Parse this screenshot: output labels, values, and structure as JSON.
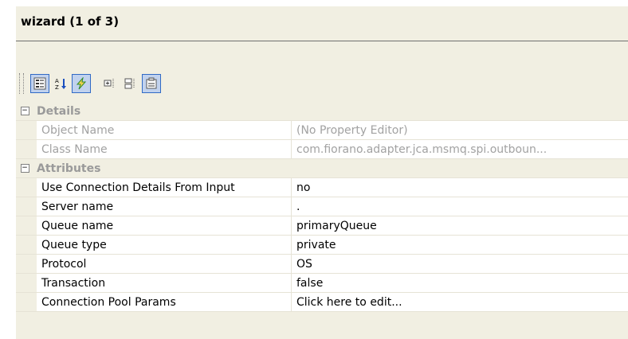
{
  "panel": {
    "title": "wizard (1 of 3)"
  },
  "toolbar": {
    "buttons": [
      {
        "icon": "categorized-icon",
        "active": true
      },
      {
        "icon": "sort-alphabetical-icon",
        "active": false
      },
      {
        "icon": "lightning-icon",
        "active": true
      },
      {
        "icon": "expand-all-icon",
        "active": false
      },
      {
        "icon": "collapse-all-icon",
        "active": false
      },
      {
        "icon": "property-pages-icon",
        "active": true
      }
    ]
  },
  "categories": {
    "details": {
      "label": "Details",
      "rows": [
        {
          "name": "Object Name",
          "value": "(No Property Editor)"
        },
        {
          "name": "Class Name",
          "value": "com.fiorano.adapter.jca.msmq.spi.outboun..."
        }
      ]
    },
    "attributes": {
      "label": "Attributes",
      "rows": [
        {
          "name": "Use Connection Details From Input",
          "value": "no"
        },
        {
          "name": "Server name",
          "value": "."
        },
        {
          "name": "Queue name",
          "value": "primaryQueue"
        },
        {
          "name": "Queue type",
          "value": "private"
        },
        {
          "name": "Protocol",
          "value": "OS"
        },
        {
          "name": "Transaction",
          "value": "false"
        },
        {
          "name": "Connection Pool Params",
          "value": "Click here to edit..."
        }
      ]
    }
  },
  "colors": {
    "panel_bg": "#f1efe2",
    "active_button": "#c1d2ee",
    "readonly_text": "#a2a2a2"
  }
}
